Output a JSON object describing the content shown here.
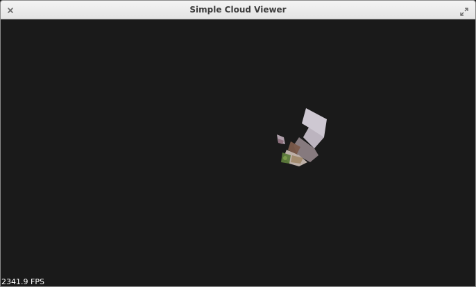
{
  "window": {
    "title": "Simple Cloud Viewer"
  },
  "icons": {
    "close": "close-icon",
    "maximize": "maximize-icon"
  },
  "viewport": {
    "fps_text": "2341.9 FPS"
  },
  "colors": {
    "background": "#1a1a1a",
    "titlebar": "#e8e8e8",
    "title_text": "#3c3c3c",
    "fps_text": "#ffffff"
  }
}
